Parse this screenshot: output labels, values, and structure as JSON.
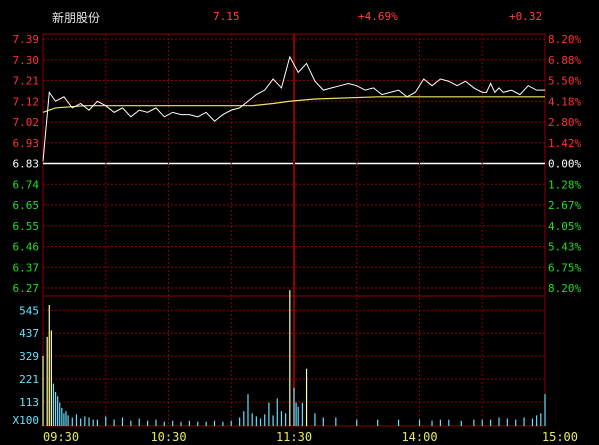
{
  "header": {
    "name": "新朋股份",
    "price": "7.15",
    "change_pct": "+4.69%",
    "change": "+0.32"
  },
  "colors": {
    "grid": "#8b0000",
    "up": "#ff3030",
    "down": "#22dd22",
    "flat": "#ffffff",
    "price_line": "#ffffff",
    "avg_line": "#e8e860",
    "volume": "#66e0ff",
    "volume_unit": "#66e0ff",
    "time": "#e8e860"
  },
  "chart_data": [
    {
      "type": "line",
      "title": "",
      "y_left_ticks": [
        "7.39",
        "7.30",
        "7.21",
        "7.12",
        "7.02",
        "6.93",
        "6.83",
        "6.74",
        "6.65",
        "6.55",
        "6.46",
        "6.37",
        "6.27"
      ],
      "y_right_ticks": [
        "8.20%",
        "6.88%",
        "5.50%",
        "4.18%",
        "2.80%",
        "1.42%",
        "0.00%",
        "1.28%",
        "2.67%",
        "4.05%",
        "5.43%",
        "6.75%",
        "8.20%"
      ],
      "ylim": [
        6.27,
        7.39
      ],
      "prev_close": 6.83,
      "x_ticks": [
        "09:30",
        "10:30",
        "11:30",
        "14:00",
        "15:00"
      ],
      "series": [
        {
          "x": [
            0,
            3,
            6,
            10,
            14,
            18,
            22,
            26,
            30,
            34,
            38,
            42,
            46,
            50,
            54,
            58,
            62,
            66,
            70,
            74,
            78,
            82,
            86,
            90,
            94,
            98,
            102,
            106,
            110,
            114,
            118,
            122,
            126,
            130,
            134,
            138,
            142,
            146,
            150,
            154,
            158,
            162,
            166,
            170,
            174,
            178,
            182,
            186,
            190,
            194,
            198,
            202,
            206,
            210,
            212,
            214,
            216,
            218,
            220,
            224,
            228,
            232,
            236,
            240
          ],
          "y": [
            6.84,
            7.15,
            7.11,
            7.13,
            7.08,
            7.1,
            7.07,
            7.11,
            7.09,
            7.06,
            7.08,
            7.04,
            7.07,
            7.06,
            7.08,
            7.04,
            7.06,
            7.05,
            7.05,
            7.04,
            7.06,
            7.02,
            7.05,
            7.07,
            7.08,
            7.11,
            7.14,
            7.16,
            7.21,
            7.17,
            7.31,
            7.24,
            7.28,
            7.2,
            7.16,
            7.17,
            7.18,
            7.19,
            7.18,
            7.16,
            7.17,
            7.14,
            7.15,
            7.16,
            7.13,
            7.15,
            7.21,
            7.18,
            7.21,
            7.2,
            7.18,
            7.2,
            7.17,
            7.15,
            7.15,
            7.19,
            7.15,
            7.17,
            7.15,
            7.16,
            7.14,
            7.18,
            7.16,
            7.16
          ]
        },
        {
          "x": [
            0,
            6,
            20,
            60,
            100,
            110,
            118,
            130,
            160,
            200,
            240
          ],
          "y": [
            7.06,
            7.08,
            7.09,
            7.09,
            7.09,
            7.1,
            7.11,
            7.12,
            7.13,
            7.13,
            7.13
          ]
        }
      ]
    },
    {
      "type": "bar",
      "title": "",
      "unit": "X100",
      "y_ticks": [
        "545",
        "437",
        "329",
        "221",
        "113"
      ],
      "ylim": [
        0,
        650
      ],
      "x": [
        0,
        2,
        3,
        4,
        5,
        6,
        7,
        8,
        9,
        10,
        11,
        12,
        14,
        16,
        18,
        20,
        22,
        24,
        26,
        30,
        34,
        38,
        42,
        46,
        50,
        54,
        58,
        62,
        66,
        70,
        74,
        78,
        82,
        86,
        90,
        94,
        96,
        98,
        100,
        102,
        104,
        106,
        108,
        110,
        112,
        114,
        116,
        118,
        120,
        121,
        122,
        124,
        126,
        130,
        134,
        140,
        150,
        160,
        170,
        180,
        186,
        190,
        194,
        200,
        206,
        210,
        214,
        218,
        222,
        226,
        230,
        234,
        236,
        238,
        240
      ],
      "values": [
        330,
        420,
        570,
        450,
        200,
        160,
        140,
        110,
        85,
        60,
        70,
        50,
        40,
        55,
        35,
        45,
        40,
        30,
        30,
        45,
        30,
        40,
        25,
        35,
        25,
        30,
        20,
        25,
        20,
        25,
        20,
        20,
        25,
        20,
        25,
        40,
        70,
        150,
        60,
        45,
        35,
        55,
        110,
        50,
        130,
        70,
        60,
        640,
        180,
        110,
        90,
        110,
        270,
        60,
        40,
        40,
        30,
        30,
        30,
        30,
        25,
        30,
        30,
        25,
        30,
        30,
        30,
        40,
        35,
        30,
        40,
        35,
        50,
        60,
        150
      ]
    }
  ]
}
